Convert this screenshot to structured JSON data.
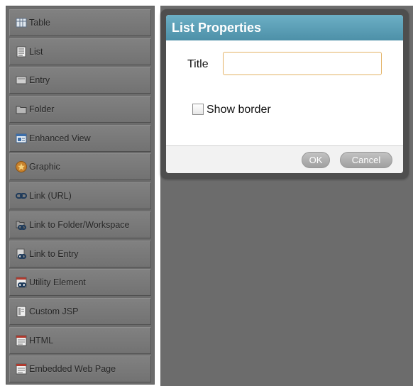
{
  "palette": {
    "items": [
      {
        "label": "Table",
        "icon": "table-icon"
      },
      {
        "label": "List",
        "icon": "list-icon"
      },
      {
        "label": "Entry",
        "icon": "entry-icon"
      },
      {
        "label": "Folder",
        "icon": "folder-icon"
      },
      {
        "label": "Enhanced View",
        "icon": "enhanced-view-icon"
      },
      {
        "label": "Graphic",
        "icon": "graphic-icon"
      },
      {
        "label": "Link (URL)",
        "icon": "link-icon"
      },
      {
        "label": "Link to Folder/Workspace",
        "icon": "link-folder-icon"
      },
      {
        "label": "Link to Entry",
        "icon": "link-entry-icon"
      },
      {
        "label": "Utility Element",
        "icon": "utility-element-icon"
      },
      {
        "label": "Custom JSP",
        "icon": "custom-jsp-icon"
      },
      {
        "label": "HTML",
        "icon": "html-icon"
      },
      {
        "label": "Embedded Web Page",
        "icon": "embedded-web-page-icon"
      }
    ]
  },
  "dialog": {
    "title": "List Properties",
    "title_field_label": "Title",
    "title_field_value": "",
    "show_border_label": "Show border",
    "show_border_checked": false,
    "ok_label": "OK",
    "cancel_label": "Cancel"
  },
  "colors": {
    "header": "#5a9db5",
    "panel": "#6c6c6c",
    "input_border": "#e3b264"
  }
}
